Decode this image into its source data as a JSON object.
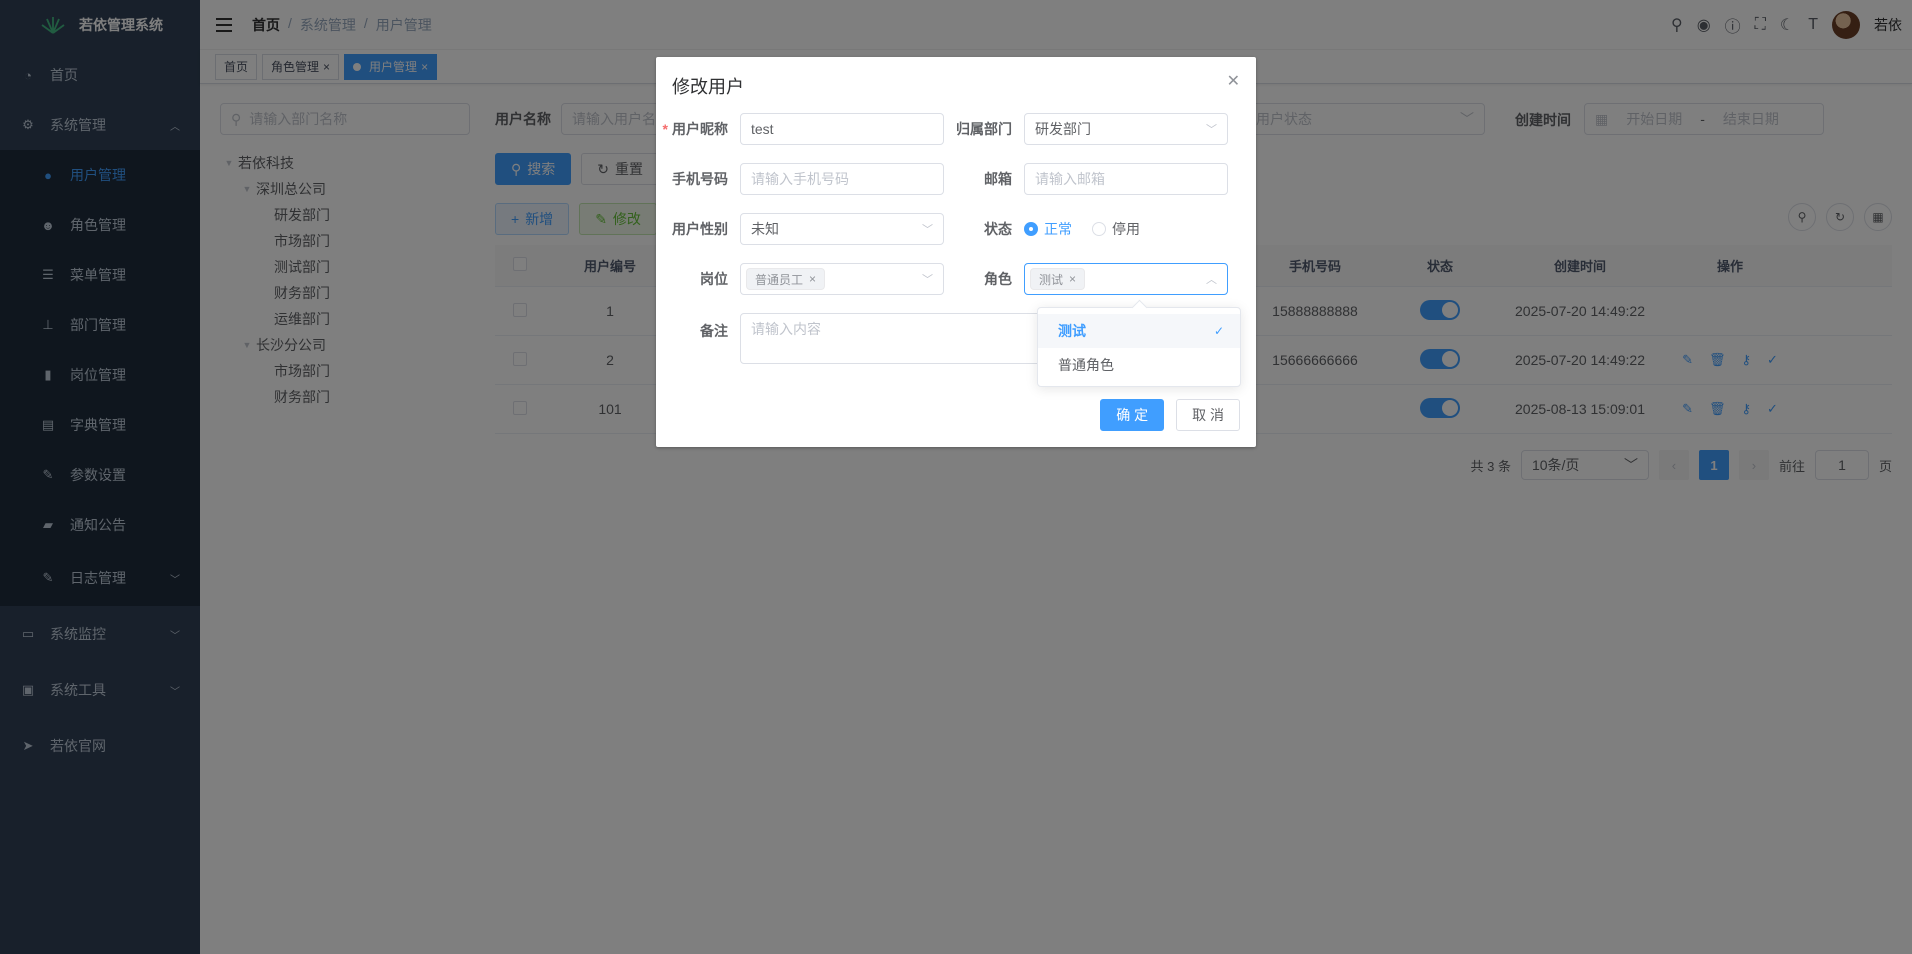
{
  "app": {
    "title": "若依管理系统"
  },
  "sidebar": {
    "items": [
      {
        "label": "首页",
        "icon": "dashboard-icon"
      },
      {
        "label": "系统管理",
        "icon": "gear-icon",
        "expanded": true,
        "children": [
          {
            "label": "用户管理",
            "icon": "user-icon",
            "active": true
          },
          {
            "label": "角色管理",
            "icon": "peoples-icon"
          },
          {
            "label": "菜单管理",
            "icon": "tree-table-icon"
          },
          {
            "label": "部门管理",
            "icon": "tree-icon"
          },
          {
            "label": "岗位管理",
            "icon": "post-icon"
          },
          {
            "label": "字典管理",
            "icon": "dict-icon"
          },
          {
            "label": "参数设置",
            "icon": "edit-icon"
          },
          {
            "label": "通知公告",
            "icon": "message-icon"
          },
          {
            "label": "日志管理",
            "icon": "log-icon"
          }
        ]
      },
      {
        "label": "系统监控",
        "icon": "monitor-icon"
      },
      {
        "label": "系统工具",
        "icon": "tool-icon"
      },
      {
        "label": "若依官网",
        "icon": "guide-icon"
      }
    ]
  },
  "navbar": {
    "breadcrumb": [
      "首页",
      "系统管理",
      "用户管理"
    ],
    "username": "若依"
  },
  "tags": [
    {
      "label": "首页"
    },
    {
      "label": "角色管理"
    },
    {
      "label": "用户管理",
      "active": true
    }
  ],
  "dept": {
    "search_placeholder": "请输入部门名称",
    "tree": [
      {
        "label": "若依科技",
        "level": 0
      },
      {
        "label": "深圳总公司",
        "level": 1
      },
      {
        "label": "研发部门",
        "level": 2
      },
      {
        "label": "市场部门",
        "level": 2
      },
      {
        "label": "测试部门",
        "level": 2
      },
      {
        "label": "财务部门",
        "level": 2
      },
      {
        "label": "运维部门",
        "level": 2
      },
      {
        "label": "长沙分公司",
        "level": 1
      },
      {
        "label": "市场部门",
        "level": 2
      },
      {
        "label": "财务部门",
        "level": 2
      }
    ]
  },
  "filter": {
    "username_label": "用户名称",
    "username_placeholder": "请输入用户名称",
    "status_placeholder": "用户状态",
    "created_label": "创建时间",
    "start_placeholder": "开始日期",
    "end_placeholder": "结束日期",
    "range_sep": "-"
  },
  "buttons": {
    "search": "搜索",
    "reset": "重置",
    "add": "新增",
    "edit": "修改"
  },
  "table": {
    "headers": {
      "id": "用户编号",
      "phone": "手机号码",
      "status": "状态",
      "created": "创建时间",
      "ops": "操作"
    },
    "rows": [
      {
        "id": "1",
        "phone": "15888888888",
        "created": "2025-07-20 14:49:22"
      },
      {
        "id": "2",
        "phone": "15666666666",
        "created": "2025-07-20 14:49:22"
      },
      {
        "id": "101",
        "phone": "",
        "created": "2025-08-13 15:09:01"
      }
    ]
  },
  "pagination": {
    "total": "共 3 条",
    "page_size": "10条/页",
    "current": "1",
    "goto_label": "前往",
    "goto_value": "1",
    "page_suffix": "页"
  },
  "dialog": {
    "title": "修改用户",
    "nickname_label": "用户昵称",
    "nickname_value": "test",
    "dept_label": "归属部门",
    "dept_value": "研发部门",
    "phone_label": "手机号码",
    "phone_placeholder": "请输入手机号码",
    "email_label": "邮箱",
    "email_placeholder": "请输入邮箱",
    "gender_label": "用户性别",
    "gender_value": "未知",
    "status_label": "状态",
    "status_normal": "正常",
    "status_disabled": "停用",
    "post_label": "岗位",
    "post_chip": "普通员工",
    "role_label": "角色",
    "role_chip": "测试",
    "remark_label": "备注",
    "remark_placeholder": "请输入内容",
    "confirm": "确 定",
    "cancel": "取 消"
  },
  "role_dropdown": {
    "options": [
      {
        "label": "测试",
        "selected": true
      },
      {
        "label": "普通角色",
        "selected": false
      }
    ]
  },
  "colors": {
    "primary": "#409eff",
    "sidebar_bg": "#304156",
    "submenu_bg": "#1f2d3d"
  }
}
